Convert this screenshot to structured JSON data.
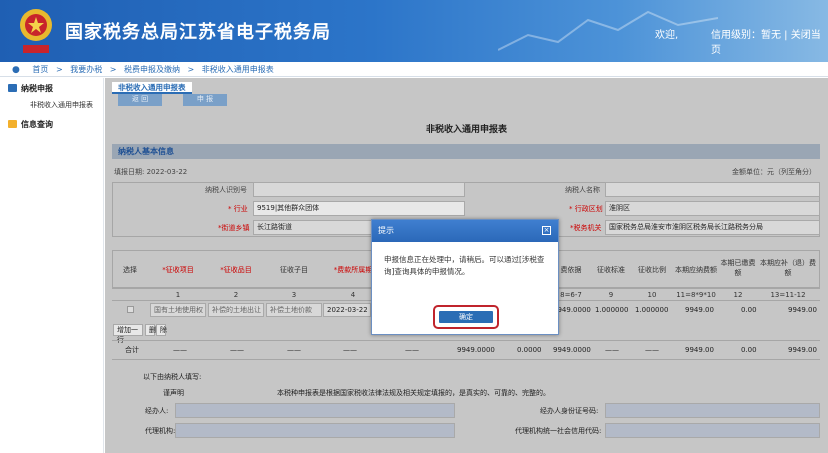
{
  "header": {
    "title": "国家税务总局江苏省电子税务局",
    "welcome": "欢迎,",
    "level_text": "信用级别：暂无 | 关闭当页",
    "brand_color": "#1f5fb3"
  },
  "breadcrumb": {
    "items": [
      "首页",
      ">",
      "我要办税",
      ">",
      "税费申报及缴纳",
      ">",
      "非税收入通用申报表"
    ]
  },
  "sidebar": {
    "groups": [
      {
        "label": "纳税申报",
        "items": [
          "非税收入通用申报表"
        ]
      },
      {
        "label": "信息查询",
        "items": []
      }
    ]
  },
  "main": {
    "tab": "非税收入通用申报表",
    "btn1": "返 回",
    "btn2": "申 报",
    "form_title": "非税收入通用申报表",
    "section_title": "纳税人基本信息",
    "fill_date": "填报日期:   2022-03-22",
    "unit": "金额单位：元（列至角分）",
    "labels": {
      "taxpayer_id": "纳税人识别号",
      "taxpayer_name": "纳税人名称",
      "industry": "* 行业",
      "district": "* 行政区划",
      "street": "*街道乡镇",
      "tax_office": "*税务机关"
    },
    "values": {
      "industry": "9519|其他群众团体",
      "district": "淮阴区",
      "street": "长江路街道",
      "tax_office": "国家税务总局淮安市淮阴区税务局长江路税务分局"
    },
    "table": {
      "headers": [
        "选择",
        "*征收项目",
        "*征收品目",
        "征收子目",
        "*费款所属期",
        "",
        "",
        "费依据",
        "征收标准",
        "征收比例",
        "本期应纳费额",
        "本期已缴费额",
        "本期应补（退）费额"
      ],
      "index_row": [
        "",
        "1",
        "2",
        "3",
        "4",
        "",
        "",
        "8=6-7",
        "9",
        "10",
        "11=8*9*10",
        "12",
        "13=11-12"
      ],
      "data_row": [
        "",
        "国有土地使用权",
        "补偿的土地出让",
        "补偿土地价款",
        "2022-03-22",
        "",
        "",
        "9949.0000",
        "1.000000",
        "1.000000",
        "9949.00",
        "0.00",
        "9949.00"
      ],
      "actions": [
        "增加一行",
        "删",
        "除"
      ],
      "total_label": "合计",
      "total_row": [
        "——",
        "——",
        "——",
        "——",
        "——",
        "9949.0000",
        "0.0000",
        "9949.0000",
        "——",
        "——",
        "9949.00",
        "0.00",
        "9949.00"
      ]
    },
    "footer": {
      "fill_by": "以下由纳税人填写:",
      "declaration_label": "谨声明",
      "declaration": "本税种申报表是根据国家税收法律法规及相关规定填报的，是真实的、可靠的、完整的。",
      "handler": "经办人:",
      "handler_id": "经办人身份证号码:",
      "agent": "代理机构:",
      "agent_code": "代理机构统一社会信用代码:"
    }
  },
  "dialog": {
    "title": "提示",
    "message": "申报信息正在处理中，请稍后。可以通过[涉税查询]查询具体的申报情况。",
    "ok": "确定",
    "highlight_color": "#c0242c"
  }
}
